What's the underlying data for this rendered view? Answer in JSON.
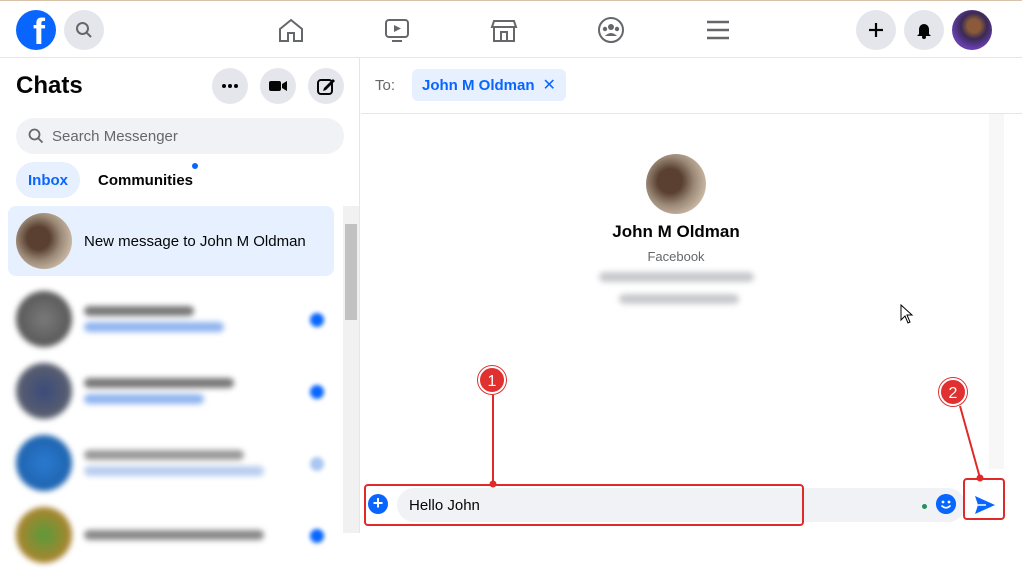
{
  "topbar": {
    "logo_letter": "f",
    "nav": [
      "home-icon",
      "watch-icon",
      "marketplace-icon",
      "groups-icon",
      "menu-icon"
    ]
  },
  "left": {
    "title": "Chats",
    "search_placeholder": "Search Messenger",
    "tabs": [
      {
        "label": "Inbox",
        "active": true
      },
      {
        "label": "Communities",
        "active": false
      }
    ],
    "items": [
      {
        "label": "New message to John M Oldman",
        "active": true
      }
    ]
  },
  "conversation": {
    "to_label": "To:",
    "recipient": "John M Oldman",
    "profile_name": "John M Oldman",
    "profile_sub": "Facebook",
    "message_value": "Hello John"
  },
  "annotations": [
    {
      "number": "1"
    },
    {
      "number": "2"
    }
  ],
  "colors": {
    "accent": "#0866ff",
    "highlight": "#e02a2a"
  }
}
